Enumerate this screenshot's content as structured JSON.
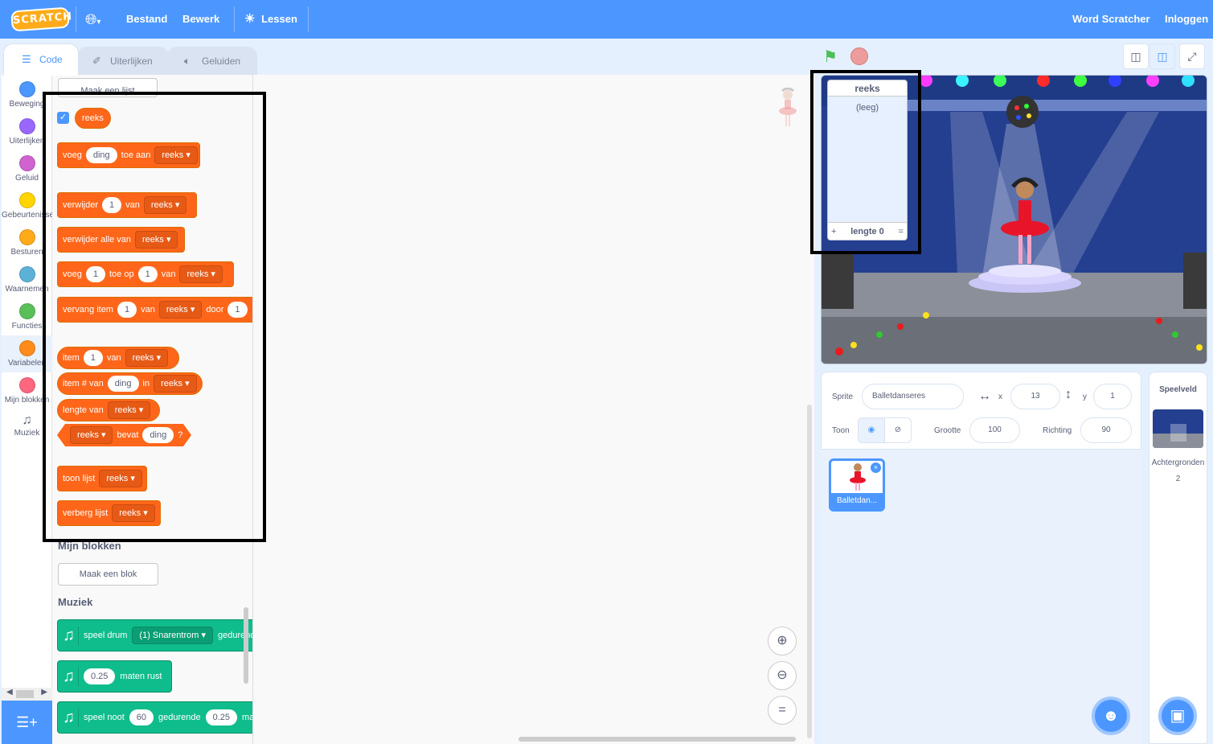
{
  "menubar": {
    "logo": "SCRATCH",
    "menu_items": [
      "Bestand",
      "Bewerk"
    ],
    "tutorials": "Lessen",
    "join": "Word Scratcher",
    "signin": "Inloggen"
  },
  "tabs": {
    "code": "Code",
    "costumes": "Uiterlijken",
    "sounds": "Geluiden"
  },
  "categories": [
    {
      "label": "Beweging",
      "color": "#4c97ff"
    },
    {
      "label": "Uiterlijken",
      "color": "#9966ff"
    },
    {
      "label": "Geluid",
      "color": "#cf63cf"
    },
    {
      "label": "Gebeurtenissen",
      "color": "#ffd500"
    },
    {
      "label": "Besturen",
      "color": "#ffab19"
    },
    {
      "label": "Waarnemen",
      "color": "#5cb1d6"
    },
    {
      "label": "Functies",
      "color": "#59c059"
    },
    {
      "label": "Variabelen",
      "color": "#ff8c1a"
    },
    {
      "label": "Mijn blokken",
      "color": "#ff6680"
    },
    {
      "label": "Muziek",
      "color": "#0fbd8c"
    }
  ],
  "palette": {
    "make_list": "Maak een lijst",
    "list_reporter": "reeks",
    "blocks": {
      "add": {
        "a": "voeg",
        "item": "ding",
        "b": "toe aan",
        "list": "reeks"
      },
      "delete": {
        "a": "verwijder",
        "n": "1",
        "b": "van",
        "list": "reeks"
      },
      "delete_all": {
        "a": "verwijder alle van",
        "list": "reeks"
      },
      "insert": {
        "a": "voeg",
        "n": "1",
        "b": "toe op",
        "m": "1",
        "c": "van",
        "list": "reeks"
      },
      "replace": {
        "a": "vervang item",
        "n": "1",
        "b": "van",
        "list": "reeks",
        "c": "door",
        "m": "1"
      },
      "item": {
        "a": "item",
        "n": "1",
        "b": "van",
        "list": "reeks"
      },
      "item_num": {
        "a": "item # van",
        "item": "ding",
        "b": "in",
        "list": "reeks"
      },
      "length": {
        "a": "lengte van",
        "list": "reeks"
      },
      "contains": {
        "list": "reeks",
        "a": "bevat",
        "item": "ding",
        "q": "?"
      },
      "show": {
        "a": "toon lijst",
        "list": "reeks"
      },
      "hide": {
        "a": "verberg lijst",
        "list": "reeks"
      }
    },
    "my_blocks_head": "Mijn blokken",
    "make_block": "Maak een blok",
    "music_head": "Muziek",
    "music": {
      "drum": {
        "a": "speel drum",
        "drum": "(1) Snarentrom",
        "b": "gedurende"
      },
      "rest": {
        "n": "0.25",
        "a": "maten rust"
      },
      "note": {
        "a": "speel noot",
        "n": "60",
        "b": "gedurende",
        "m": "0.25",
        "c": "maten"
      }
    }
  },
  "list_monitor": {
    "title": "reeks",
    "empty": "(leeg)",
    "add": "+",
    "length": "lengte 0",
    "resize": "="
  },
  "sprite_info": {
    "sprite_label": "Sprite",
    "sprite_name": "Balletdanseres",
    "x_label": "x",
    "x": "13",
    "y_label": "y",
    "y": "1",
    "show_label": "Toon",
    "size_label": "Grootte",
    "size": "100",
    "dir_label": "Richting",
    "direction": "90"
  },
  "sprites": [
    {
      "name": "Balletdan..."
    }
  ],
  "stage_panel": {
    "title": "Speelveld",
    "backdrops_label": "Achtergronden",
    "backdrops_count": "2"
  },
  "colors": {
    "accent": "#4c97ff",
    "variables": "#ff661a",
    "music": "#0fbd8c"
  }
}
